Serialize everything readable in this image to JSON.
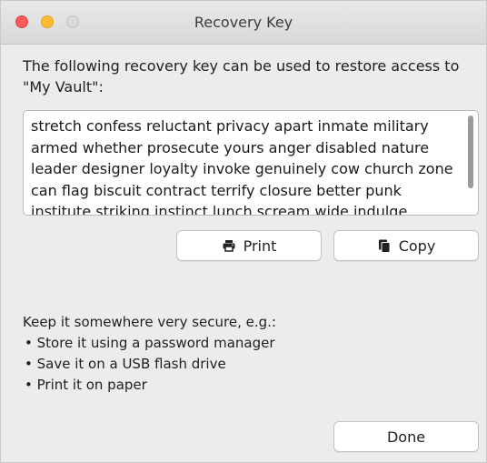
{
  "window": {
    "title": "Recovery Key"
  },
  "dialog": {
    "intro": "The following recovery key can be used to restore access to \"My Vault\":",
    "recovery_key": "stretch confess reluctant privacy apart inmate military armed whether prosecute yours anger disabled nature leader designer loyalty invoke genuinely cow church zone can flag biscuit contract terrify closure better punk institute striking instinct lunch scream wide indulge",
    "buttons": {
      "print_label": "Print",
      "copy_label": "Copy",
      "done_label": "Done"
    },
    "tips": {
      "heading": "Keep it somewhere very secure, e.g.:",
      "items": [
        "Store it using a password manager",
        "Save it on a USB flash drive",
        "Print it on paper"
      ]
    }
  },
  "icons": {
    "print": "printer-icon",
    "copy": "copy-icon"
  },
  "colors": {
    "close": "#fc5b57",
    "minimize": "#fdbd2e",
    "zoom": "#d9d9d9"
  }
}
